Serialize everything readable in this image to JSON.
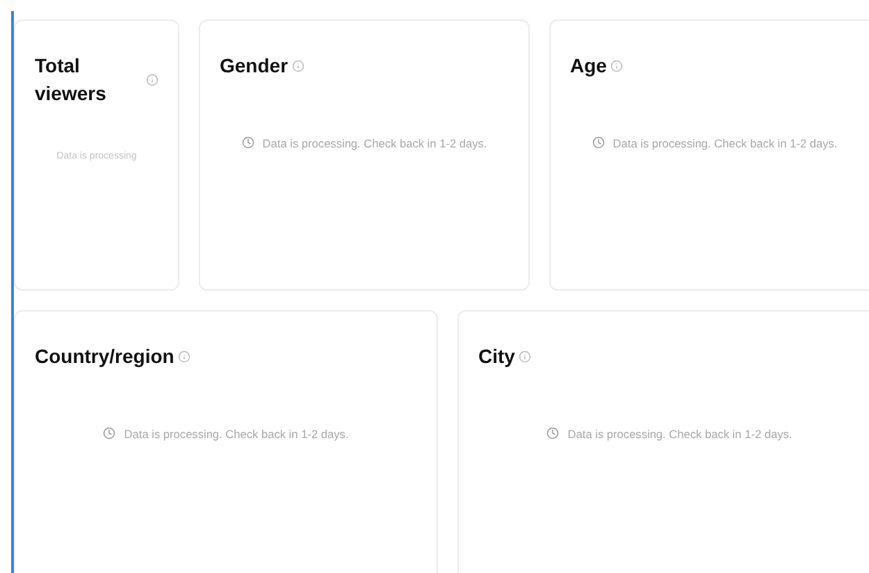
{
  "rows": [
    {
      "cards": [
        {
          "kind": "summary",
          "title": "Total viewers",
          "message": "Data is processing"
        },
        {
          "kind": "breakdown",
          "title": "Gender",
          "message": "Data is processing. Check back in 1-2 days."
        },
        {
          "kind": "breakdown",
          "title": "Age",
          "message": "Data is processing. Check back in 1-2 days."
        }
      ]
    },
    {
      "cards": [
        {
          "kind": "breakdown",
          "title": "Country/region",
          "message": "Data is processing. Check back in 1-2 days."
        },
        {
          "kind": "breakdown",
          "title": "City",
          "message": "Data is processing. Check back in 1-2 days."
        }
      ]
    }
  ]
}
